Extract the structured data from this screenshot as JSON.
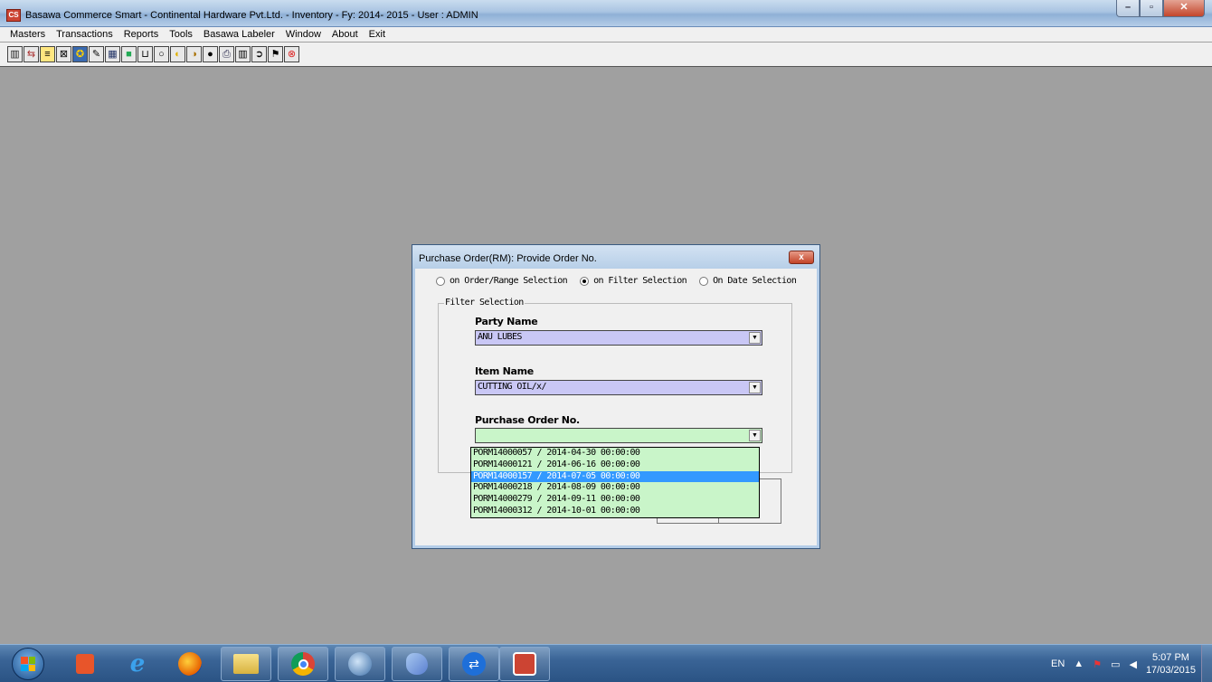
{
  "window": {
    "title": "Basawa Commerce Smart - Continental Hardware Pvt.Ltd. - Inventory  -  Fy: 2014- 2015 - User : ADMIN",
    "icon_label": "CS"
  },
  "menu": [
    "Masters",
    "Transactions",
    "Reports",
    "Tools",
    "Basawa Labeler",
    "Window",
    "About",
    "Exit"
  ],
  "toolbar_icons": [
    "chart-icon",
    "exchange-icon",
    "list-icon",
    "cross-icon",
    "gear-icon",
    "pencil-icon",
    "grid-icon",
    "book-icon",
    "bracket-icon",
    "circle-empty-icon",
    "circle-half-icon",
    "circle-half-dark-icon",
    "circle-full-icon",
    "printer-icon",
    "barcode-icon",
    "arrow-circle-icon",
    "flag-icon",
    "exit-icon"
  ],
  "dialog": {
    "title": "Purchase Order(RM): Provide Order No.",
    "close_label": "x",
    "radio_options": [
      {
        "label": "on Order/Range Selection",
        "selected": false
      },
      {
        "label": "on Filter Selection",
        "selected": true
      },
      {
        "label": "On Date Selection",
        "selected": false
      }
    ],
    "group_title": "Filter Selection",
    "party_name_label": "Party Name",
    "party_name_value": "ANU LUBES",
    "item_name_label": "Item Name",
    "item_name_value": "CUTTING OIL/x/",
    "po_label": "Purchase Order No.",
    "po_value": "",
    "po_options": [
      "PORM14000057 / 2014-04-30 00:00:00",
      "PORM14000121 / 2014-06-16 00:00:00",
      "PORM14000157 / 2014-07-05 00:00:00",
      "PORM14000218 / 2014-08-09 00:00:00",
      "PORM14000279 / 2014-09-11 00:00:00",
      "PORM14000312 / 2014-10-01 00:00:00"
    ],
    "highlighted_option_index": 2,
    "colors": {
      "combo_purple": "#c9c7f5",
      "combo_green": "#c9f5c9",
      "highlight": "#3399ff"
    }
  },
  "taskbar": {
    "apps": [
      "office-icon",
      "ie-icon",
      "firefox-icon",
      "folder-icon",
      "chrome-icon",
      "thunderbird-icon",
      "dolphin-icon",
      "teamviewer-icon",
      "basawa-icon"
    ],
    "language": "EN",
    "time": "5:07 PM",
    "date": "17/03/2015"
  }
}
